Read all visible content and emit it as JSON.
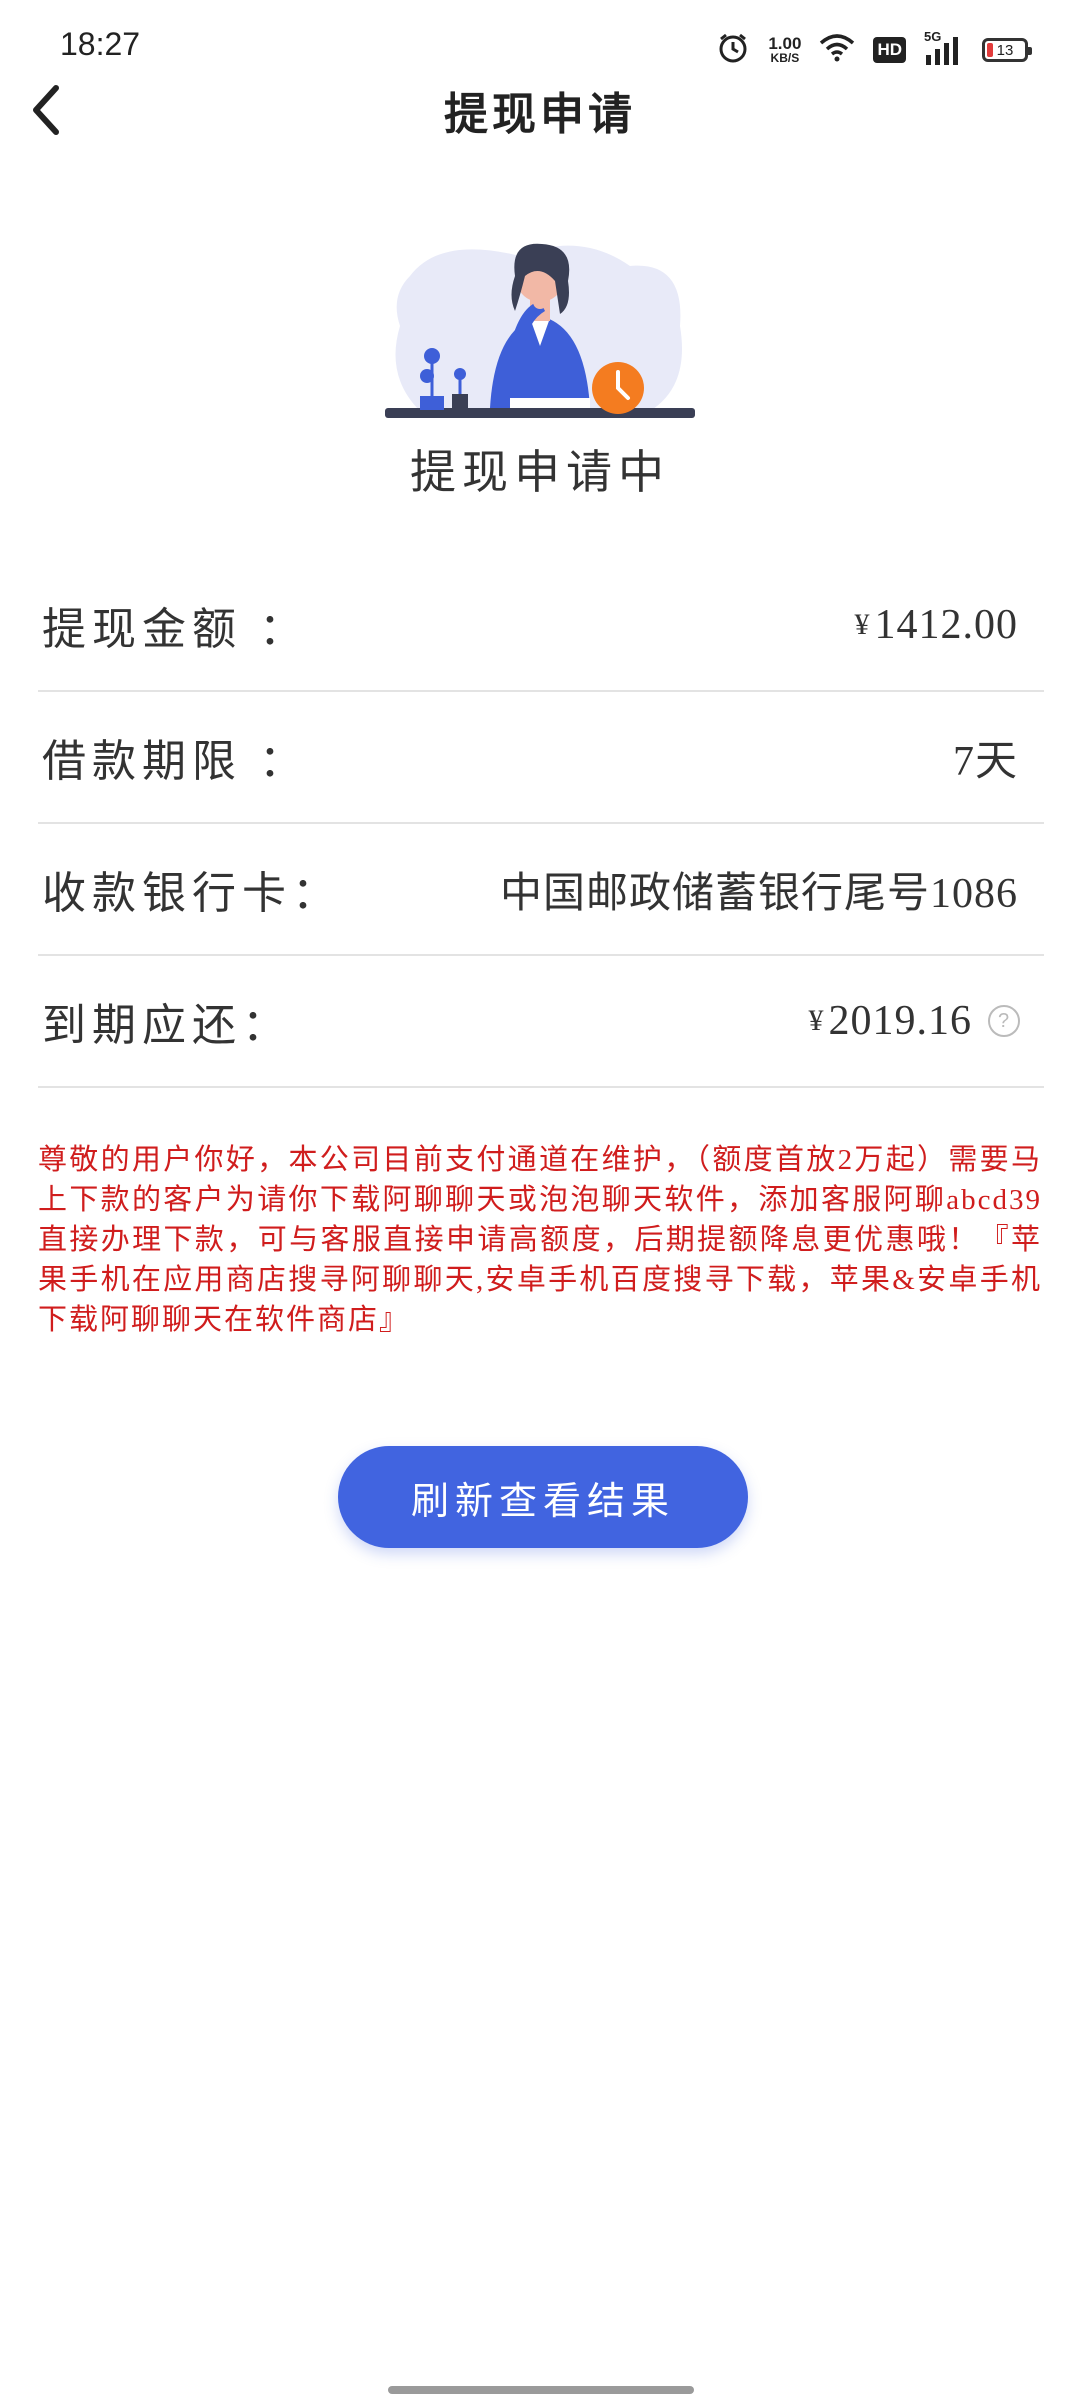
{
  "status_bar": {
    "time": "18:27",
    "net_speed_value": "1.00",
    "net_speed_unit": "KB/S",
    "hd": "HD",
    "signal_type": "5G",
    "battery_level": "13",
    "icons": [
      "alarm-icon",
      "wifi-icon",
      "signal-icon",
      "battery-icon"
    ]
  },
  "nav": {
    "title": "提现申请",
    "back_icon": "chevron-left-icon"
  },
  "status_text": "提现申请中",
  "info": {
    "amount_label": "提现金额 ：",
    "amount_currency": "¥",
    "amount_value": "1412.00",
    "term_label": "借款期限 ：",
    "term_value": "7天",
    "bank_label": "收款银行卡：",
    "bank_value": "中国邮政储蓄银行尾号1086",
    "due_label": "到期应还：",
    "due_currency": "¥",
    "due_value": "2019.16",
    "help_icon": "question-circle-icon"
  },
  "notice": "尊敬的用户你好，本公司目前支付通道在维护，（额度首放2万起）需要马上下款的客户为请你下载阿聊聊天或泡泡聊天软件，添加客服阿聊abcd39 直接办理下款，可与客服直接申请高额度，后期提额降息更优惠哦！『苹果手机在应用商店搜寻阿聊聊天,安卓手机百度搜寻下载，苹果&安卓手机下载阿聊聊天在软件商店』",
  "refresh_button": "刷新查看结果",
  "colors": {
    "accent": "#4164e0",
    "notice": "#d01d1d",
    "divider": "#e3e3e3"
  }
}
